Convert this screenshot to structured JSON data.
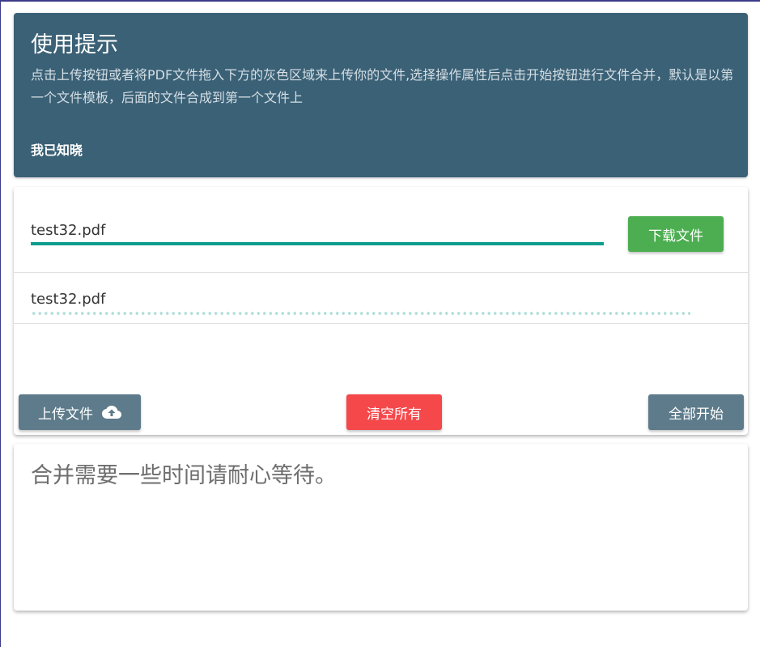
{
  "tips": {
    "title": "使用提示",
    "body": "点击上传按钮或者将PDF文件拖入下方的灰色区域来上传你的文件,选择操作属性后点击开始按钮进行文件合并，默认是以第一个文件模板，后面的文件合成到第一个文件上",
    "ack_label": "我已知晓"
  },
  "files": [
    {
      "name": "test32.pdf",
      "progress_percent": 100,
      "status": "complete",
      "action_label": "下载文件"
    },
    {
      "name": "test32.pdf",
      "status": "pending"
    }
  ],
  "toolbar": {
    "upload_label": "上传文件",
    "upload_icon": "cloud-upload-icon",
    "clear_label": "清空所有",
    "start_all_label": "全部开始"
  },
  "message": {
    "text": "合并需要一些时间请耐心等待。"
  },
  "colors": {
    "tips_bg": "#3b6176",
    "progress": "#0e9c8c",
    "download": "#4cae50",
    "clear": "#f5484b",
    "neutral_button": "#5d7b8b"
  }
}
